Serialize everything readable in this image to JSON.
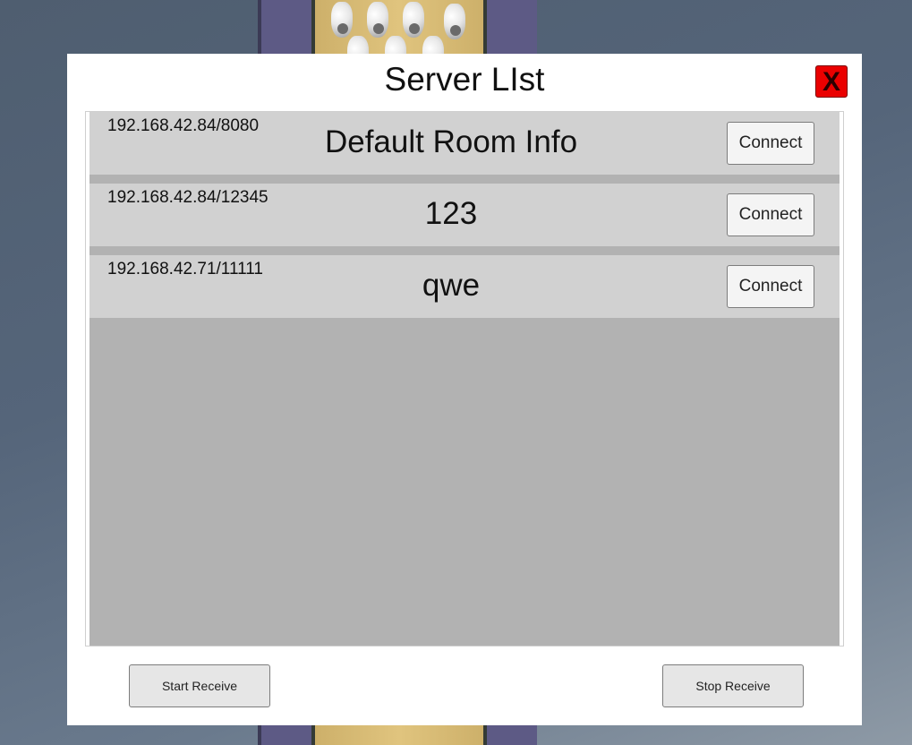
{
  "dialog": {
    "title": "Server LIst",
    "close_label": "X"
  },
  "servers": [
    {
      "address": "192.168.42.84/8080",
      "room": "Default Room Info",
      "connect_label": "Connect"
    },
    {
      "address": "192.168.42.84/12345",
      "room": "123",
      "connect_label": "Connect"
    },
    {
      "address": "192.168.42.71/11111",
      "room": "qwe",
      "connect_label": "Connect"
    }
  ],
  "controls": {
    "start_label": "Start Receive",
    "stop_label": "Stop Receive"
  },
  "colors": {
    "close_button": "#ea0000",
    "row_background": "#d1d1d1",
    "list_background": "#b2b2b2"
  }
}
